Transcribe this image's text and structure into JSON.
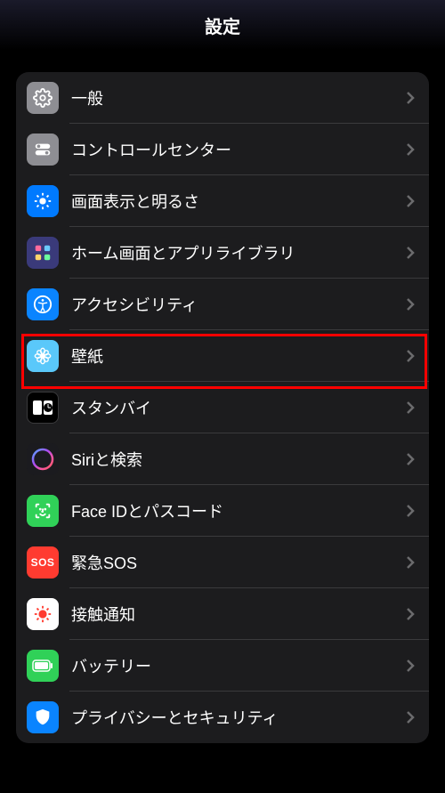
{
  "header": {
    "title": "設定"
  },
  "rows": [
    {
      "id": "general",
      "label": "一般",
      "icon": "gear-icon"
    },
    {
      "id": "control-center",
      "label": "コントロールセンター",
      "icon": "toggles-icon"
    },
    {
      "id": "display",
      "label": "画面表示と明るさ",
      "icon": "brightness-icon"
    },
    {
      "id": "home-screen",
      "label": "ホーム画面とアプリライブラリ",
      "icon": "grid-icon"
    },
    {
      "id": "accessibility",
      "label": "アクセシビリティ",
      "icon": "accessibility-icon"
    },
    {
      "id": "wallpaper",
      "label": "壁紙",
      "icon": "flower-icon",
      "highlighted": true
    },
    {
      "id": "standby",
      "label": "スタンバイ",
      "icon": "standby-icon"
    },
    {
      "id": "siri",
      "label": "Siriと検索",
      "icon": "siri-icon"
    },
    {
      "id": "faceid",
      "label": "Face IDとパスコード",
      "icon": "faceid-icon"
    },
    {
      "id": "emergency-sos",
      "label": "緊急SOS",
      "icon": "sos-icon"
    },
    {
      "id": "exposure",
      "label": "接触通知",
      "icon": "exposure-icon"
    },
    {
      "id": "battery",
      "label": "バッテリー",
      "icon": "battery-icon"
    },
    {
      "id": "privacy",
      "label": "プライバシーとセキュリティ",
      "icon": "privacy-icon"
    }
  ]
}
